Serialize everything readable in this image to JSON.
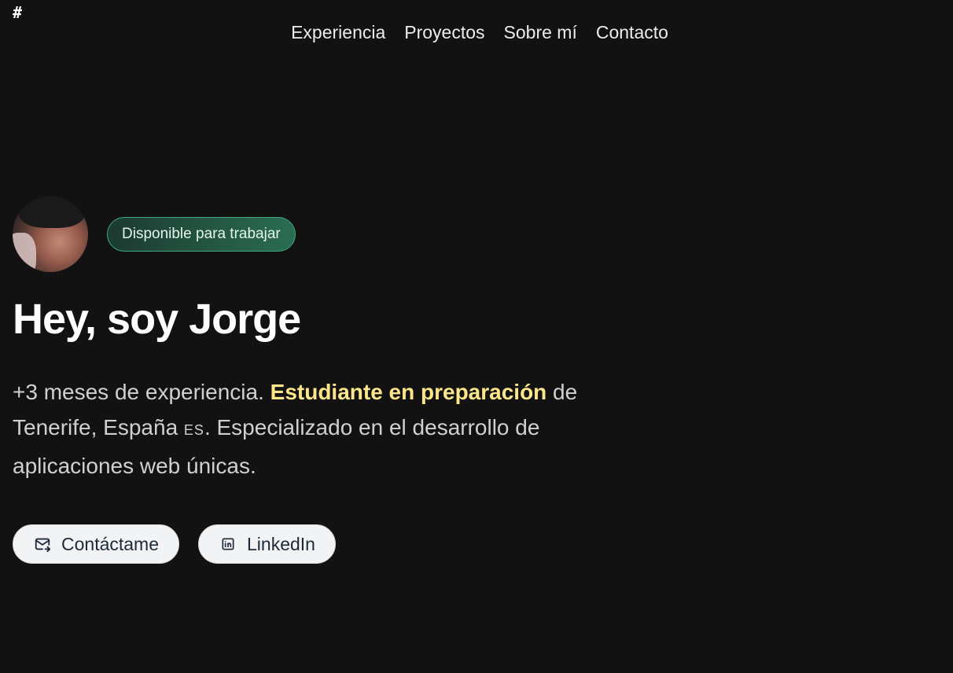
{
  "header": {
    "logo_text": "#",
    "nav": [
      {
        "label": "Experiencia"
      },
      {
        "label": "Proyectos"
      },
      {
        "label": "Sobre mí"
      },
      {
        "label": "Contacto"
      }
    ]
  },
  "hero": {
    "badge": "Disponible para trabajar",
    "title": "Hey, soy Jorge",
    "description": {
      "part1": "+3 meses de experiencia. ",
      "highlight": "Estudiante en preparación",
      "part2": " de Tenerife, España ",
      "flag": "ES",
      "part3": ". Especializado en el desarrollo de aplicaciones web únicas."
    },
    "buttons": {
      "contact": {
        "label": "Contáctame",
        "icon": "mail-icon"
      },
      "linkedin": {
        "label": "LinkedIn",
        "icon": "linkedin-icon"
      }
    }
  },
  "colors": {
    "background": "#121212",
    "highlight": "#fde68a",
    "badge_border": "#3fa87c"
  }
}
